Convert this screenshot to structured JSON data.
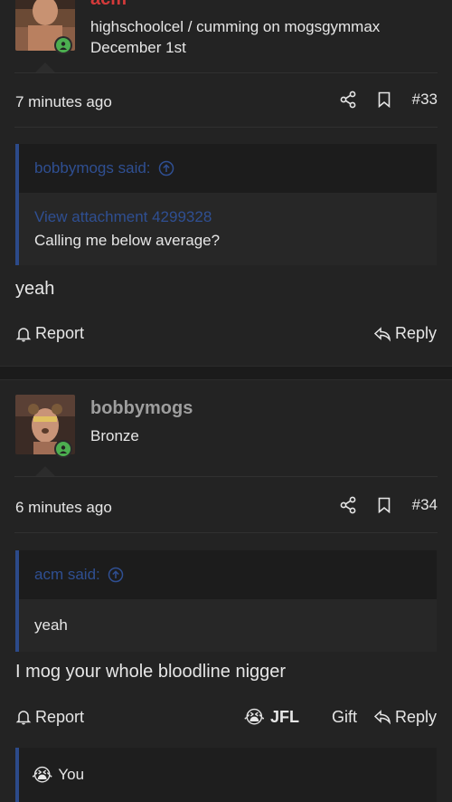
{
  "post33": {
    "username": "acm",
    "user_title": "highschoolcel / cumming on mogsgymmax",
    "joined": "December 1st",
    "time": "7 minutes ago",
    "post_number": "#33",
    "quote": {
      "author": "bobbymogs said:",
      "attachment": "View attachment 4299328",
      "text": "Calling me below average?"
    },
    "message": "yeah",
    "actions": {
      "report": "Report",
      "reply": "Reply"
    }
  },
  "post34": {
    "username": "bobbymogs",
    "user_title": "Bronze",
    "time": "6 minutes ago",
    "post_number": "#34",
    "quote": {
      "author": "acm said:",
      "text": "yeah"
    },
    "message": "I mog your whole bloodline nigger",
    "actions": {
      "report": "Report",
      "reaction": "JFL",
      "gift": "Gift",
      "reply": "Reply"
    }
  },
  "reactions_bar": {
    "label": "You"
  },
  "colors": {
    "accent": "#2f4f92",
    "online": "#4caf50",
    "username_red": "#d33a3a",
    "background": "#232323"
  }
}
